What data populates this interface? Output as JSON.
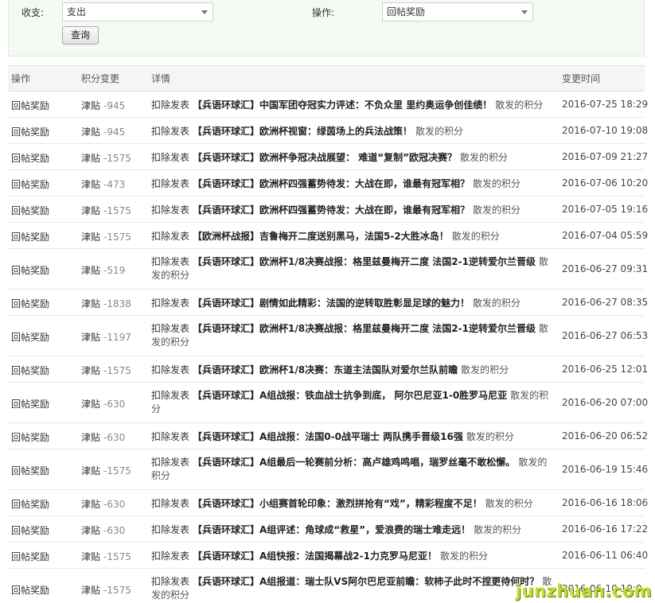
{
  "filter": {
    "income_label": "收支:",
    "income_value": "支出",
    "action_label": "操作:",
    "action_value": "回帖奖励",
    "query_button": "查询"
  },
  "table": {
    "headers": [
      "操作",
      "积分变更",
      "详情",
      "变更时间"
    ],
    "rows": [
      {
        "op": "回帖奖励",
        "unit": "津贴",
        "amount": "-945",
        "prefix": "扣除发表",
        "title": "【兵语环球汇】中国军团夺冠实力评述：不负众里 里约奥运争创佳绩！",
        "suffix": "散发的积分",
        "time": "2016-07-25 18:29"
      },
      {
        "op": "回帖奖励",
        "unit": "津贴",
        "amount": "-945",
        "prefix": "扣除发表",
        "title": "【兵语环球汇】欧洲杯视窗：绿茵场上的兵法战策！",
        "suffix": "散发的积分",
        "time": "2016-07-10 19:08"
      },
      {
        "op": "回帖奖励",
        "unit": "津贴",
        "amount": "-1575",
        "prefix": "扣除发表",
        "title": "【兵语环球汇】欧洲杯争冠决战展望： 难道“复制”欧冠决赛？",
        "suffix": "散发的积分",
        "time": "2016-07-09 21:27"
      },
      {
        "op": "回帖奖励",
        "unit": "津贴",
        "amount": "-473",
        "prefix": "扣除发表",
        "title": "【兵语环球汇】欧洲杯四强蓄势待发：大战在即，谁最有冠军相？",
        "suffix": "散发的积分",
        "time": "2016-07-06 10:20"
      },
      {
        "op": "回帖奖励",
        "unit": "津贴",
        "amount": "-1575",
        "prefix": "扣除发表",
        "title": "【兵语环球汇】欧洲杯四强蓄势待发：大战在即，谁最有冠军相？",
        "suffix": "散发的积分",
        "time": "2016-07-05 19:16"
      },
      {
        "op": "回帖奖励",
        "unit": "津贴",
        "amount": "-1575",
        "prefix": "扣除发表",
        "title": "【欧洲杯战报】吉鲁梅开二度送别黑马，法国5-2大胜冰岛！",
        "suffix": "散发的积分",
        "time": "2016-07-04 05:59"
      },
      {
        "op": "回帖奖励",
        "unit": "津贴",
        "amount": "-519",
        "prefix": "扣除发表",
        "title": "【兵语环球汇】欧洲杯1/8决赛战报：格里兹曼梅开二度 法国2-1逆转爱尔兰晋级",
        "suffix": "散发的积分",
        "time": "2016-06-27 09:31"
      },
      {
        "op": "回帖奖励",
        "unit": "津贴",
        "amount": "-1838",
        "prefix": "扣除发表",
        "title": "【兵语环球汇】剧情如此精彩：法国的逆转取胜彰显足球的魅力！",
        "suffix": "散发的积分",
        "time": "2016-06-27 08:35"
      },
      {
        "op": "回帖奖励",
        "unit": "津贴",
        "amount": "-1197",
        "prefix": "扣除发表",
        "title": "【兵语环球汇】欧洲杯1/8决赛战报：格里兹曼梅开二度 法国2-1逆转爱尔兰晋级",
        "suffix": "散发的积分",
        "time": "2016-06-27 06:53"
      },
      {
        "op": "回帖奖励",
        "unit": "津贴",
        "amount": "-1575",
        "prefix": "扣除发表",
        "title": "【兵语环球汇】欧洲杯1/8决赛：东道主法国队对爱尔兰队前瞻",
        "suffix": "散发的积分",
        "time": "2016-06-25 12:01"
      },
      {
        "op": "回帖奖励",
        "unit": "津贴",
        "amount": "-630",
        "prefix": "扣除发表",
        "title": "【兵语环球汇】A组战报：铁血战士抗争到底， 阿尔巴尼亚1-0胜罗马尼亚",
        "suffix": "散发的积分",
        "time": "2016-06-20 07:00"
      },
      {
        "op": "回帖奖励",
        "unit": "津贴",
        "amount": "-630",
        "prefix": "扣除发表",
        "title": "【兵语环球汇】A组战报：法国0-0战平瑞士 两队携手晋级16强",
        "suffix": "散发的积分",
        "time": "2016-06-20 06:52"
      },
      {
        "op": "回帖奖励",
        "unit": "津贴",
        "amount": "-1575",
        "prefix": "扣除发表",
        "title": "【兵语环球汇】A组最后一轮赛前分析：高卢雄鸡鸣唱，瑞罗丝毫不敢松懈。",
        "suffix": "散发的积分",
        "time": "2016-06-19 15:46"
      },
      {
        "op": "回帖奖励",
        "unit": "津贴",
        "amount": "-630",
        "prefix": "扣除发表",
        "title": "【兵语环球汇】小组赛首轮印象：激烈拼抢有“戏”，精彩程度不足！",
        "suffix": "散发的积分",
        "time": "2016-06-16 18:06"
      },
      {
        "op": "回帖奖励",
        "unit": "津贴",
        "amount": "-630",
        "prefix": "扣除发表",
        "title": "【兵语环球汇】A组评述：角球成“救星”，爱浪费的瑞士难走远！",
        "suffix": "散发的积分",
        "time": "2016-06-16 17:22"
      },
      {
        "op": "回帖奖励",
        "unit": "津贴",
        "amount": "-1575",
        "prefix": "扣除发表",
        "title": "【兵语环球汇】A组快报：法国揭幕战2-1力克罗马尼亚！",
        "suffix": "散发的积分",
        "time": "2016-06-11 06:40"
      },
      {
        "op": "回帖奖励",
        "unit": "津贴",
        "amount": "-1575",
        "prefix": "扣除发表",
        "title": "【兵语环球汇】A组报道：瑞士队VS阿尔巴尼亚前瞻：软柿子此时不捏更待何时？",
        "suffix": "散发的积分",
        "time": "2016-06-10 10:0"
      }
    ]
  },
  "watermark": "junzhuan.com"
}
